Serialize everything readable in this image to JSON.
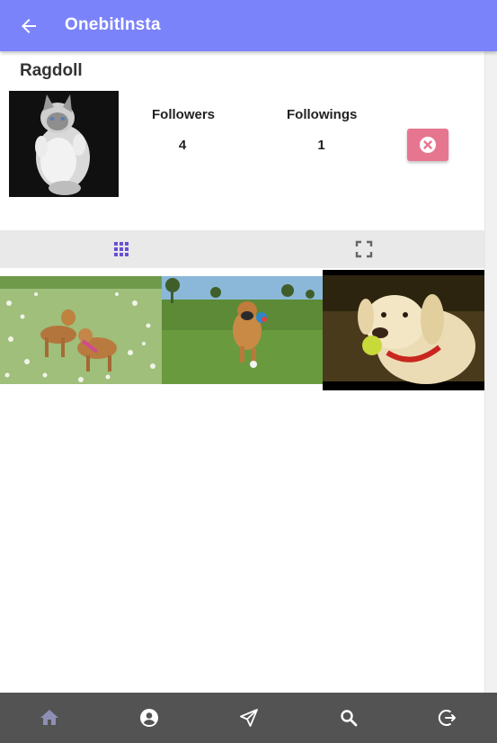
{
  "app_bar": {
    "title": "OnebitInsta",
    "back_icon": "arrow-left-icon"
  },
  "profile": {
    "username": "Ragdoll",
    "followers_label": "Followers",
    "followers_count": "4",
    "followings_label": "Followings",
    "followings_count": "1",
    "remove_icon": "close-circle-icon"
  },
  "tabs": [
    {
      "icon": "grid-icon",
      "active": true
    },
    {
      "icon": "fullscreen-icon",
      "active": false
    }
  ],
  "photos": [
    {
      "subject": "two dogs playing in a flower field"
    },
    {
      "subject": "boxer dog running with a ball"
    },
    {
      "subject": "labrador holding a tennis ball"
    }
  ],
  "bottom_nav": [
    {
      "icon": "home-icon"
    },
    {
      "icon": "account-icon"
    },
    {
      "icon": "send-icon"
    },
    {
      "icon": "search-icon"
    },
    {
      "icon": "logout-icon"
    }
  ],
  "colors": {
    "primary": "#7b83fb",
    "accent": "#e67690",
    "active_tab": "#6a4fd6",
    "nav_bg": "#535353"
  }
}
